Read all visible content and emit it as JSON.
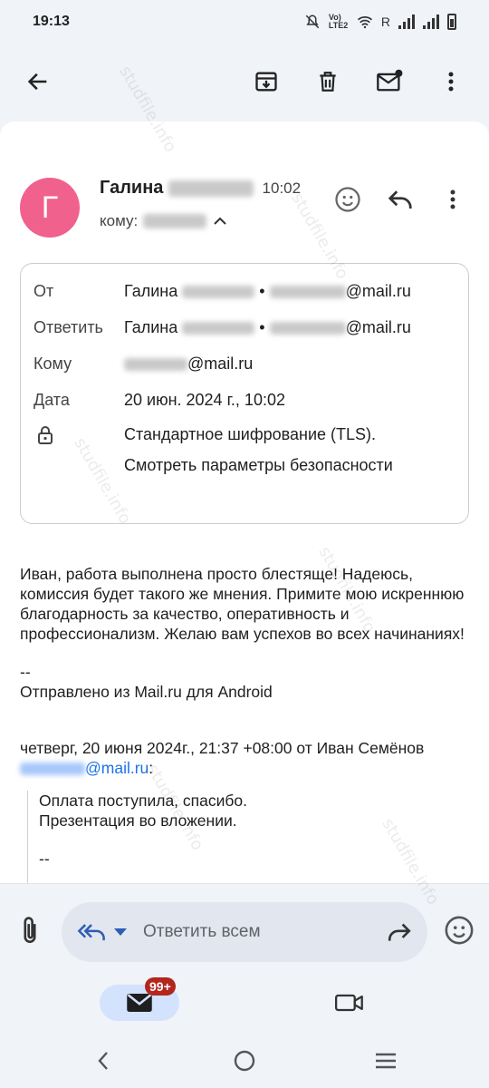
{
  "status_bar": {
    "time": "19:13",
    "carrier_label": "Vo) LTE2",
    "roaming": "R"
  },
  "toolbar": {
    "back": "arrow-back-icon",
    "archive": "archive-icon",
    "delete": "delete-icon",
    "mark_unread": "mark-unread-icon",
    "more": "more-vert-icon"
  },
  "email": {
    "avatar_letter": "Г",
    "sender_first_name": "Галина",
    "time": "10:02",
    "to_label": "кому:",
    "details": {
      "from_label": "От",
      "from_name": "Галина",
      "from_domain": "@mail.ru",
      "reply_label": "Ответить",
      "reply_name": "Галина",
      "reply_domain": "@mail.ru",
      "to_label": "Кому",
      "to_domain": "@mail.ru",
      "date_label": "Дата",
      "date_value": "20 июн. 2024 г., 10:02",
      "encryption": "Стандартное шифрование (TLS).",
      "security_link": "Смотреть параметры безопасности"
    },
    "body": "Иван, работа выполнена просто блестяще! Надеюсь, комиссия будет такого же мнения. Примите мою искреннюю благодарность за качество, оперативность и профессионализм. Желаю вам успехов во всех начинаниях!",
    "signature_sep": "--",
    "signature": "Отправлено из Mail.ru для Android",
    "quote_header": "четверг, 20 июня 2024г., 21:37 +08:00 от Иван Семёнов",
    "quote_email_domain": "@mail.ru",
    "quote_colon": ":",
    "quote_line1": "Оплата поступила, спасибо.",
    "quote_line2": "Презентация во вложении.",
    "quote_sep": "--"
  },
  "reply_bar": {
    "placeholder": "Ответить всем"
  },
  "bottom_nav": {
    "mail_badge": "99+"
  },
  "watermark_text": "studfile.info",
  "colors": {
    "avatar": "#f0618e",
    "link": "#3f5f9e",
    "email_link": "#1a73e8",
    "badge": "#b3261e",
    "mail_tab": "#d3e3fd"
  }
}
